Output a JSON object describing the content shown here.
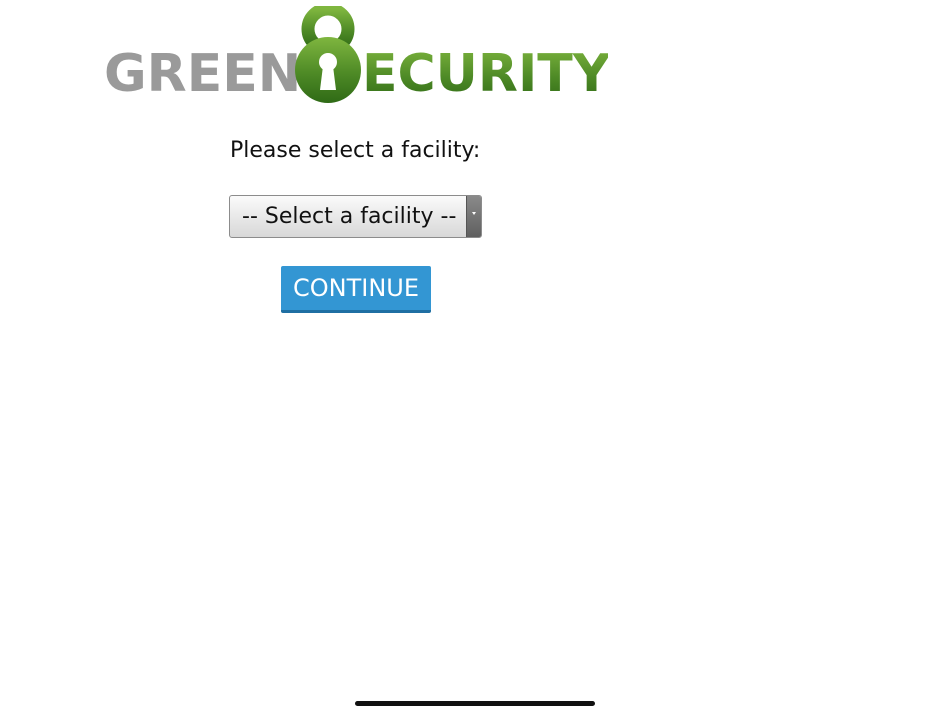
{
  "logo": {
    "word_left": "GREEN",
    "word_right": "ECURITY",
    "left_color": "#9a9a9a",
    "right_color": "#4e8a26",
    "emblem_icon": "keyhole-lock-icon"
  },
  "form": {
    "prompt": "Please select a facility:",
    "facility_select": {
      "selected": "-- Select a facility --",
      "options": [
        "-- Select a facility --"
      ]
    },
    "continue_label": "CONTINUE"
  },
  "colors": {
    "button": "#3396d3",
    "brand_green": "#4e8a26"
  }
}
